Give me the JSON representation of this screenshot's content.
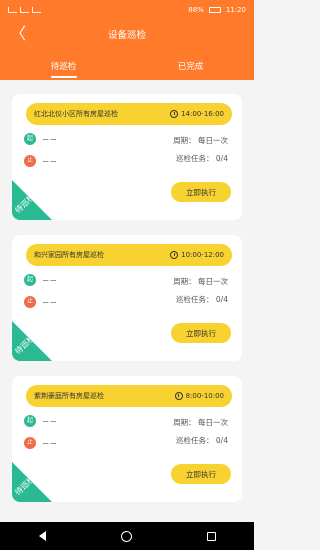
{
  "status_bar": {
    "battery": "88%",
    "time": "11:20"
  },
  "header": {
    "back_icon": "chevron-left-icon",
    "back_glyph": "〈",
    "title": "设备巡检"
  },
  "tabs": [
    {
      "label": "待巡检",
      "active": true
    },
    {
      "label": "已完成",
      "active": false
    }
  ],
  "cards": [
    {
      "name": "红北北仪小区所有房屋巡检",
      "time": "14:00-16:00",
      "start_badge": "起",
      "start_value": "－－",
      "end_badge": "止",
      "end_value": "－－",
      "period": "周期：  每日一次",
      "task": "巡检任务：  0/4",
      "action": "立即执行",
      "status": "待巡检"
    },
    {
      "name": "和兴家园所有房屋巡检",
      "time": "10:00-12:00",
      "start_badge": "起",
      "start_value": "－－",
      "end_badge": "止",
      "end_value": "－－",
      "period": "周期：  每日一次",
      "task": "巡检任务：  0/4",
      "action": "立即执行",
      "status": "待巡检"
    },
    {
      "name": "紫荆豪庭所有房屋巡检",
      "time": "8:00-10:00",
      "start_badge": "起",
      "start_value": "－－",
      "end_badge": "止",
      "end_value": "－－",
      "period": "周期：  每日一次",
      "task": "巡检任务：  0/4",
      "action": "立即执行",
      "status": "待巡检"
    }
  ],
  "colors": {
    "header": "#ff7a2a",
    "pill": "#f8d230",
    "start": "#2bb994",
    "end": "#ef6b4a"
  }
}
